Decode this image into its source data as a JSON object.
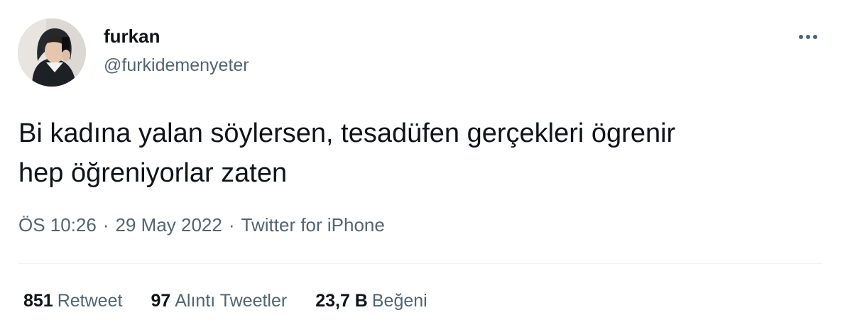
{
  "tweet": {
    "author": {
      "display_name": "furkan",
      "handle": "@furkidemenyeter"
    },
    "text": "Bi kadına yalan söylersen, tesadüfen gerçekleri ögrenir\nhep öğreniyorlar zaten",
    "meta": {
      "time": "ÖS 10:26",
      "separator": "·",
      "date": "29 May 2022",
      "source": "Twitter for iPhone"
    },
    "stats": [
      {
        "count": "851",
        "label": "Retweet"
      },
      {
        "count": "97",
        "label": "Alıntı Tweetler"
      },
      {
        "count": "23,7 B",
        "label": "Beğeni"
      }
    ]
  },
  "icons": {
    "more": "more-horizontal-icon"
  },
  "colors": {
    "text_primary": "#0f1419",
    "text_secondary": "#536471",
    "divider": "#eff3f4"
  }
}
